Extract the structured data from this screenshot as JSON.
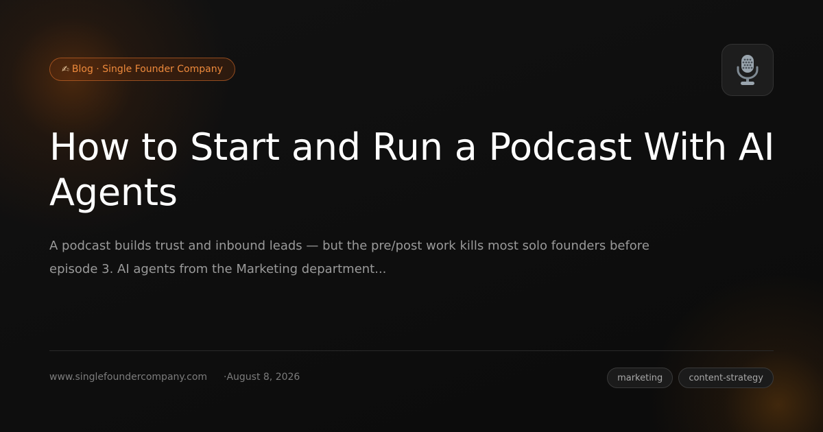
{
  "badge": {
    "icon": "writing-hand-icon",
    "label": "Blog · Single Founder Company"
  },
  "header_icon": "microphone-icon",
  "post": {
    "title": "How to Start and Run a Podcast With AI Agents",
    "summary": "A podcast builds trust and inbound leads — but the pre/post work kills most solo founders before episode 3. AI agents from the Marketing department..."
  },
  "footer": {
    "site": "www.singlefoundercompany.com",
    "date": "·August 8, 2026",
    "tags": [
      "marketing",
      "content-strategy"
    ]
  },
  "colors": {
    "accent": "#ee8a3c",
    "background": "#0c0c0c",
    "title": "#ffffff",
    "muted": "#9a9a9a"
  }
}
